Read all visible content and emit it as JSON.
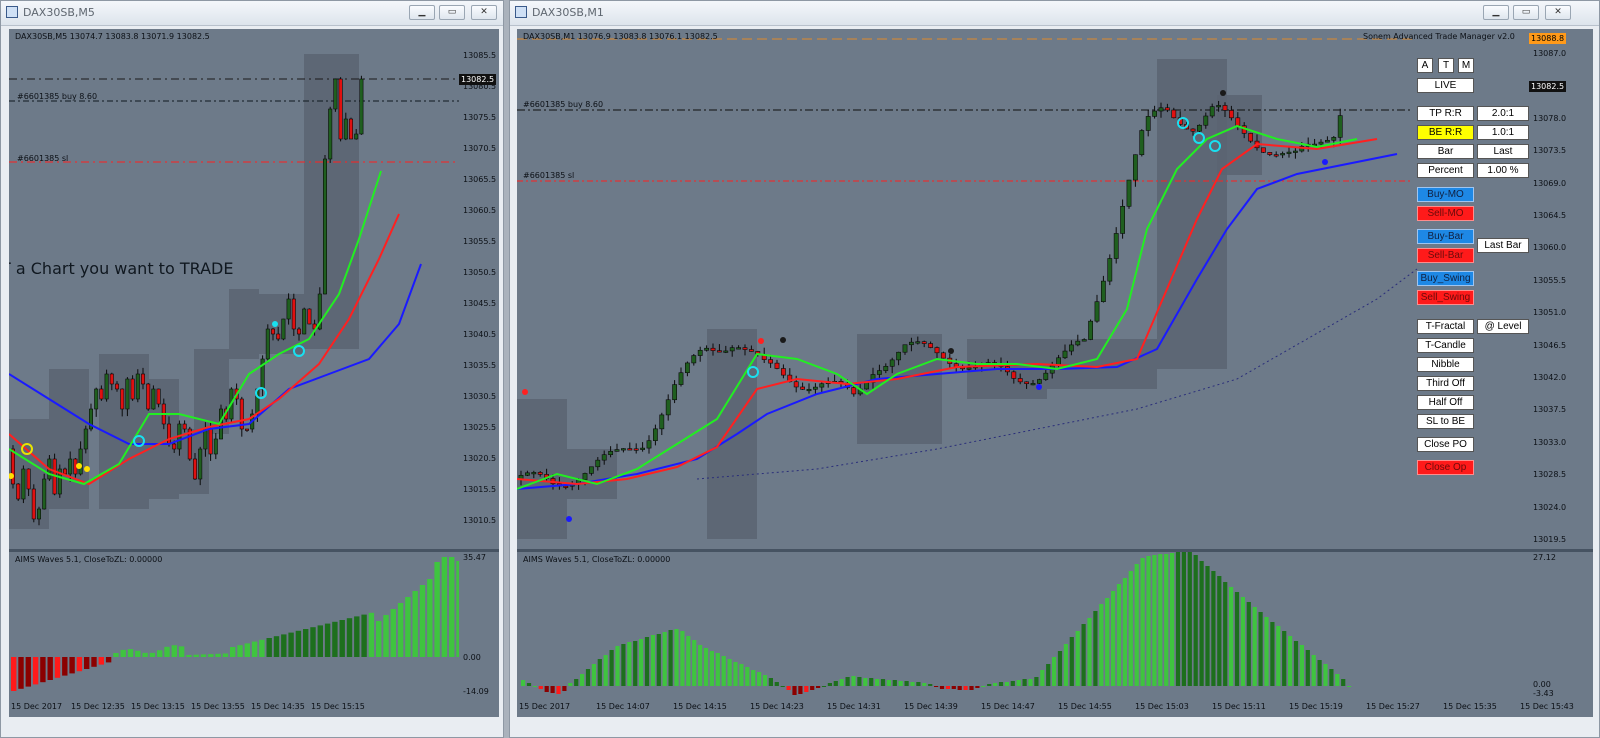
{
  "left_window": {
    "title": "DAX30SB,M5",
    "header": "DAX30SB,M5  13074.7 13083.8 13071.9 13082.5",
    "buy_label": "#6601385 buy 8.60",
    "sl_label": "#6601385 sl",
    "overlay_text": "T a Chart you want to TRADE",
    "price_ticks": [
      "13085.5",
      "13080.5",
      "13075.5",
      "13070.5",
      "13065.5",
      "13060.5",
      "13055.5",
      "13050.5",
      "13045.5",
      "13040.5",
      "13035.5",
      "13030.5",
      "13025.5",
      "13020.5",
      "13015.5",
      "13010.5"
    ],
    "current_price": "13082.5",
    "indicator_label": "AIMS Waves 5.1, CloseToZL: 0.00000",
    "indicator_ticks": [
      "35.47",
      "0.00",
      "-14.09"
    ],
    "time_ticks": [
      "15 Dec 2017",
      "15 Dec 12:35",
      "15 Dec 13:15",
      "15 Dec 13:55",
      "15 Dec 14:35",
      "15 Dec 15:15"
    ]
  },
  "right_window": {
    "title": "DAX30SB,M1",
    "header": "DAX30SB,M1  13076.9 13083.8 13076.1 13082.5",
    "manager_label": "Sonem Advanced Trade Manager v2.0",
    "buy_label": "#6601385 buy 8.60",
    "sl_label": "#6601385 sl",
    "price_ticks": [
      "13087.0",
      "13082.5",
      "13078.0",
      "13073.5",
      "13069.0",
      "13064.5",
      "13060.0",
      "13055.5",
      "13051.0",
      "13046.5",
      "13042.0",
      "13037.5",
      "13033.0",
      "13028.5",
      "13024.0",
      "13019.5"
    ],
    "current_price": "13082.5",
    "top_price": "13088.8",
    "indicator_label": "AIMS Waves 5.1, CloseToZL: 0.00000",
    "indicator_ticks": [
      "27.12",
      "0.00",
      "-3.43"
    ],
    "time_ticks": [
      "15 Dec 2017",
      "15 Dec 14:07",
      "15 Dec 14:15",
      "15 Dec 14:23",
      "15 Dec 14:31",
      "15 Dec 14:39",
      "15 Dec 14:47",
      "15 Dec 14:55",
      "15 Dec 15:03",
      "15 Dec 15:11",
      "15 Dec 15:19",
      "15 Dec 15:27",
      "15 Dec 15:35",
      "15 Dec 15:43"
    ]
  },
  "trade_panel": {
    "a": "A",
    "t": "T",
    "m": "M",
    "live": "LIVE",
    "tp_rr": "TP R:R",
    "tp_rr_value": "2.0:1",
    "be_rr": "BE R:R",
    "be_rr_value": "1.0:1",
    "bar": "Bar",
    "last": "Last",
    "percent": "Percent",
    "percent_value": "1.00 %",
    "buy_mo": "Buy-MO",
    "sell_mo": "Sell-MO",
    "buy_bar": "Buy-Bar",
    "sell_bar": "Sell-Bar",
    "last_bar": "Last Bar",
    "buy_swing": "Buy_Swing",
    "sell_swing": "Sell_Swing",
    "t_fractal": "T-Fractal",
    "at_level": "@ Level",
    "t_candle": "T-Candle",
    "nibble": "Nibble",
    "third_off": "Third Off",
    "half_off": "Half Off",
    "sl_to_be": "SL to BE",
    "close_po": "Close PO",
    "close_op": "Close Op"
  },
  "colors": {
    "chart_bg": "#6d7a89",
    "bull": "#1f5f1f",
    "bear": "#e01010",
    "ema_fast": "#22ee22",
    "ema_mid": "#ff2020",
    "ema_slow": "#1a1aff",
    "histo_up_light": "#3fc43f",
    "histo_up_dark": "#1d6f1d",
    "histo_down": "#8b0000"
  },
  "icons": {
    "window_icon": "chart-window-icon",
    "minimize": "minimize-icon",
    "maximize": "maximize-icon",
    "close": "close-icon"
  }
}
